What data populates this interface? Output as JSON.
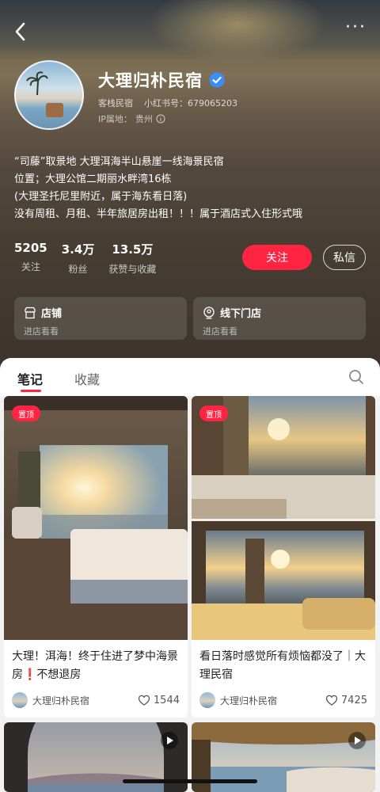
{
  "colors": {
    "accent": "#ff2442",
    "verified": "#3a8dff"
  },
  "header": {
    "shop_name": "大理归朴民宿",
    "category": "客栈民宿",
    "redbook_id_label": "小红书号：",
    "redbook_id": "679065203",
    "ip_label": "IP属地：",
    "ip_location": "贵州",
    "bio": [
      "“司藤”取景地 大理洱海半山悬崖一线海景民宿",
      "位置；大理公馆二期丽水畔湾16栋",
      "(大理圣托尼里附近，属于海东看日落)",
      "没有周租、月租、半年旅居房出租！！！属于酒店式入住形式哦"
    ]
  },
  "stats": [
    {
      "value": "5205",
      "label": "关注"
    },
    {
      "value": "3.4万",
      "label": "粉丝"
    },
    {
      "value": "13.5万",
      "label": "获赞与收藏"
    }
  ],
  "actions": {
    "follow": "关注",
    "message": "私信"
  },
  "services": [
    {
      "title": "店铺",
      "subtitle": "进店看看",
      "icon": "shop-icon"
    },
    {
      "title": "线下门店",
      "subtitle": "进店看看",
      "icon": "location-store-icon"
    }
  ],
  "tabs": [
    {
      "label": "笔记",
      "active": true
    },
    {
      "label": "收藏",
      "active": false
    }
  ],
  "notes": [
    {
      "badge": "置顶",
      "title": "大理！洱海！终于住进了梦中海景房❗️不想退房",
      "author": "大理归朴民宿",
      "likes": "1544"
    },
    {
      "badge": "置顶",
      "title": "看日落时感觉所有烦恼都没了｜大理民宿",
      "author": "大理归朴民宿",
      "likes": "7425"
    }
  ]
}
